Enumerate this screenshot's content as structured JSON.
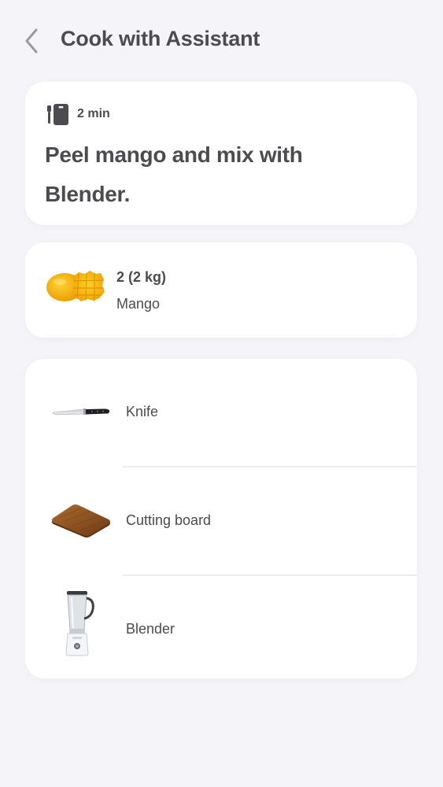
{
  "header": {
    "title": "Cook with Assistant",
    "back_icon": "chevron-left-icon"
  },
  "step": {
    "icon": "cutting-board-knife-icon",
    "time": "2 min",
    "instruction": "Peel mango and mix with Blender."
  },
  "ingredient": {
    "image": "mango-image",
    "amount": "2 (2 kg)",
    "name": "Mango"
  },
  "tools": [
    {
      "image": "knife-image",
      "label": "Knife"
    },
    {
      "image": "cutting-board-image",
      "label": "Cutting board"
    },
    {
      "image": "blender-image",
      "label": "Blender"
    }
  ],
  "colors": {
    "background": "#f4f4f9",
    "card": "#ffffff",
    "text": "#4b4b50",
    "back_icon": "#9a9aa0",
    "divider": "#ededf1",
    "mango": "#f6b200"
  }
}
